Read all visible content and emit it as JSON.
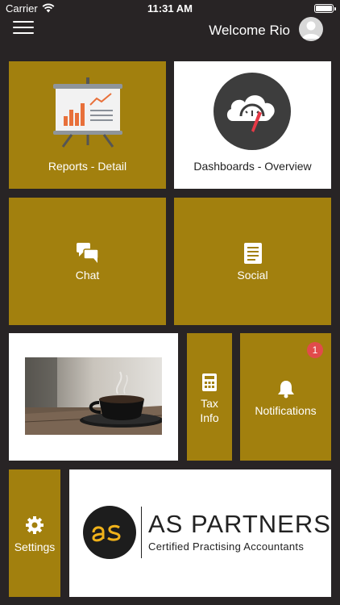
{
  "status_bar": {
    "carrier": "Carrier",
    "time": "11:31 AM"
  },
  "header": {
    "welcome": "Welcome Rio"
  },
  "tiles": {
    "reports": {
      "label": "Reports - Detail"
    },
    "dashboards": {
      "label": "Dashboards - Overview"
    },
    "chat": {
      "label": "Chat"
    },
    "social": {
      "label": "Social"
    },
    "tax": {
      "label_line1": "Tax",
      "label_line2": "Info"
    },
    "notifications": {
      "label": "Notifications",
      "badge": "1"
    },
    "settings": {
      "label": "Settings"
    }
  },
  "partner": {
    "name": "AS PARTNERS",
    "tagline": "Certified Practising Accountants"
  },
  "colors": {
    "background": "#282425",
    "tile": "#a2800e",
    "white_tile": "#ffffff",
    "badge": "#e14b4b",
    "logo_accent": "#f0b21a"
  },
  "icons": [
    "menu-icon",
    "avatar-icon",
    "presentation-board-icon",
    "cloud-gauge-icon",
    "chat-bubbles-icon",
    "document-icon",
    "calculator-icon",
    "bell-icon",
    "gear-icon",
    "coffee-cup-image"
  ]
}
